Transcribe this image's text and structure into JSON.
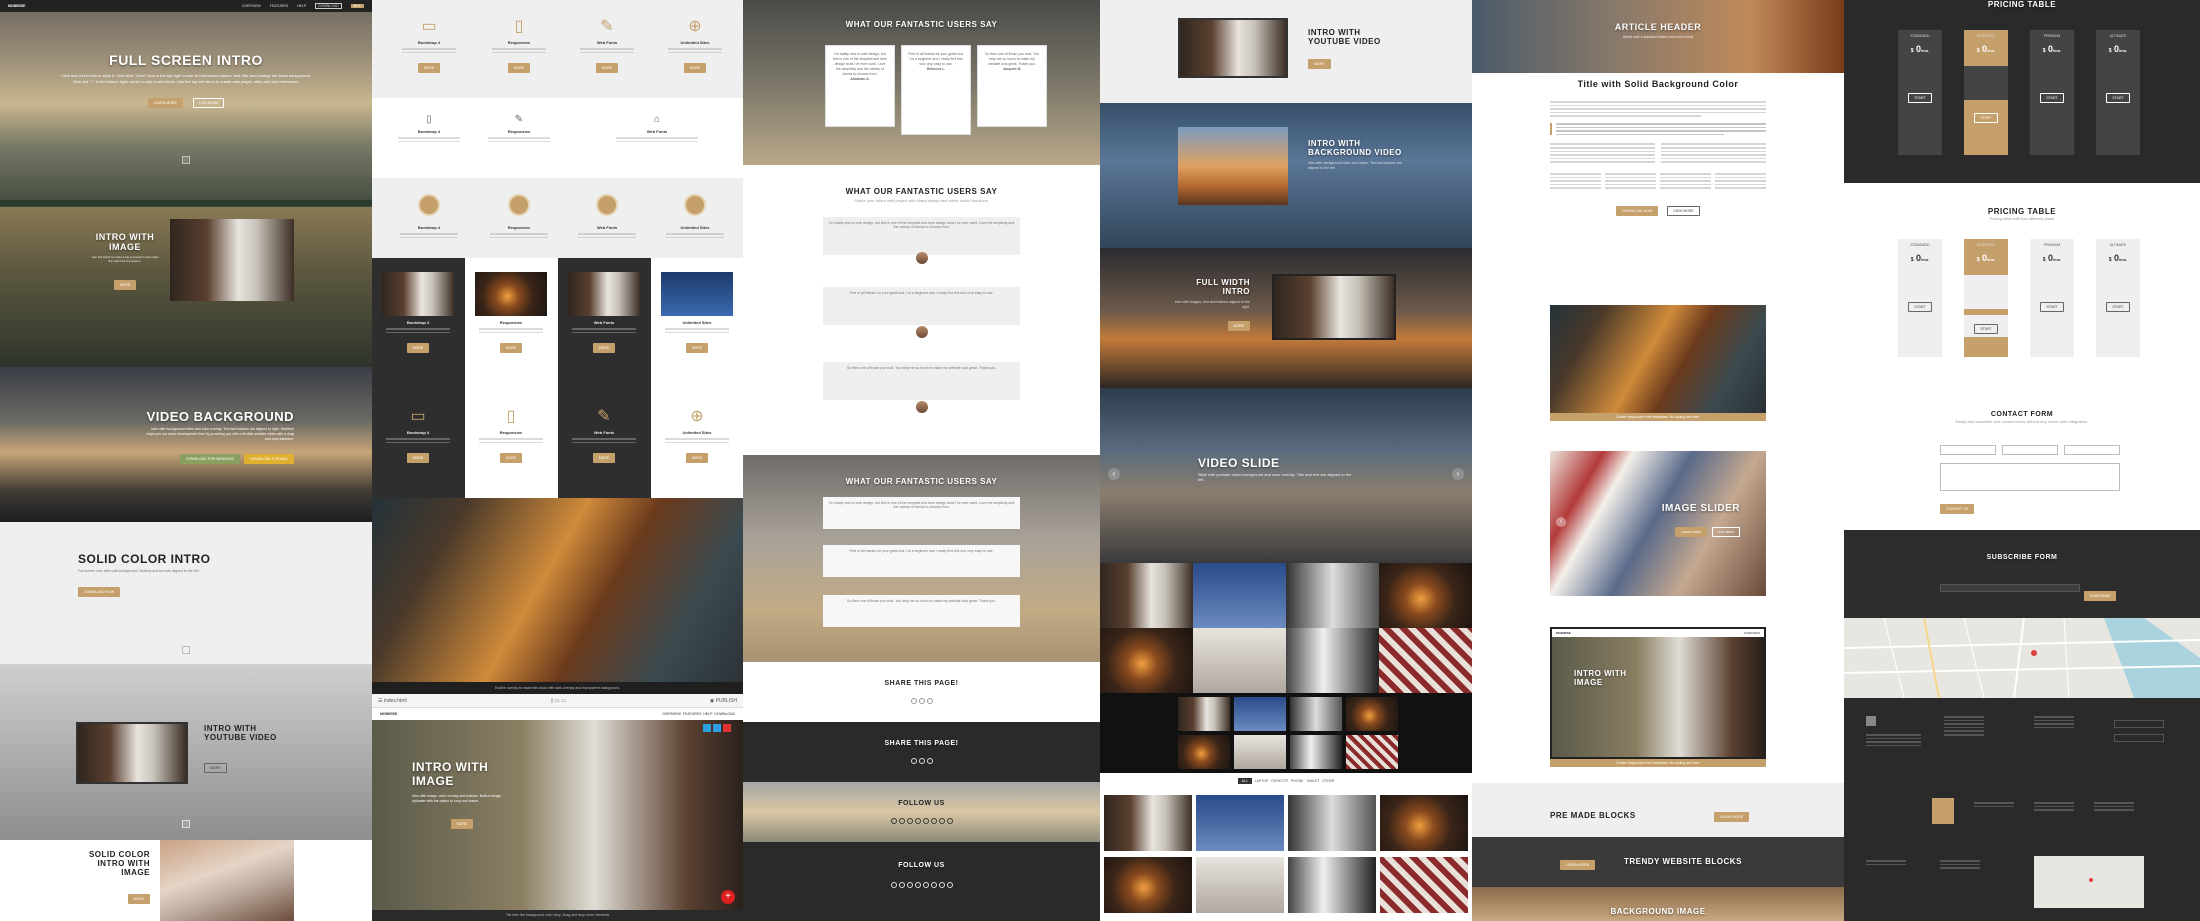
{
  "brand": "MOBIRISE",
  "nav": {
    "items": [
      "OVERVIEW",
      "FEATURES",
      "HELP",
      "DOWNLOAD",
      "BUY"
    ]
  },
  "col1": {
    "full_screen": {
      "title": "FULL SCREEN INTRO",
      "text": "Click any text to edit or style it. Click blue \"Gear\" icon in the top right corner to hide/show buttons, text, title and change the block background. Click red \"+\" in the bottom right corner to add a new block. Use the top left menu to create new pages, sites and add extensions.",
      "btn1": "LEARN MORE",
      "btn2": "LIVE DEMO"
    },
    "intro_image": {
      "title": "INTRO WITH IMAGE",
      "text": "Use this block to make a big impression and make the right first impression.",
      "btn": "MORE"
    },
    "video_bg": {
      "title": "VIDEO BACKGROUND",
      "text": "Intro with background video and color overlay. Text and buttons are aligned to right. Mobirise helps you cut down development time by providing you with a flexible website editor with a drag and drop interface.",
      "btn1": "DOWNLOAD FOR WINDOWS",
      "btn2": "DOWNLOAD FOR MAC"
    },
    "solid": {
      "title": "SOLID COLOR INTRO",
      "text": "Full screen intro with solid background. Buttons and text are aligned to the left.",
      "btn": "DOWNLOAD NOW"
    },
    "youtube": {
      "title": "INTRO WITH YOUTUBE VIDEO",
      "btn": "MORE"
    },
    "solid_image": {
      "title": "SOLID COLOR INTRO WITH IMAGE",
      "btn": "MORE"
    }
  },
  "col2": {
    "features": [
      {
        "name": "Bootstrap 4",
        "icon": "monitor-icon"
      },
      {
        "name": "Responsive",
        "icon": "phone-icon"
      },
      {
        "name": "Web Fonts",
        "icon": "pencil-icon"
      },
      {
        "name": "Unlimited Sites",
        "icon": "globe-icon"
      }
    ],
    "features_btn": "MORE",
    "caption": "Enable overlay to make this block with dark overlay and transparent background.",
    "editor": {
      "filename": "index.html",
      "publish": "PUBLISH",
      "title": "INTRO WITH IMAGE",
      "text": "Intro with image, color overlay and buttons. Built-in image uploader with the option to crop and resize.",
      "btn": "MORE",
      "caption": "Tile intro the background color drop. Drag and drop more elements"
    }
  },
  "col3": {
    "testimonials_title": "WHAT OUR FANTASTIC USERS SAY",
    "testimonials_sub": "Shape your future web project with sharp design and refine coded functions.",
    "quotes": [
      {
        "text": "I'm totally new to web design, but this is one of the simplest and best design tools I've ever used. Love the simplicity and the variety of blocks to choose from.",
        "author": "Abraham A."
      },
      {
        "text": "First of all thanks for your great tool. I'm a beginner and I really find this tool very easy to use.",
        "author": "Rebecca L."
      },
      {
        "text": "So then one of those you took. You help me so much to make my website look great. Thank you.",
        "author": "Jacques M."
      }
    ],
    "share_title": "SHARE THIS PAGE!",
    "follow_title": "FOLLOW US"
  },
  "col4": {
    "youtube": {
      "title": "INTRO WITH YOUTUBE VIDEO",
      "btn": "MORE"
    },
    "bg_video": {
      "title": "INTRO WITH BACKGROUND VIDEO",
      "text": "Intro with background video and button. Text and buttons are aligned to the left."
    },
    "full_width": {
      "title": "FULL WIDTH INTRO",
      "text": "Intro with images, text and buttons aligned to the right.",
      "btn": "MORE"
    },
    "video_slide": {
      "title": "VIDEO SLIDE",
      "text": "Slide with youtube video background and color overlay. Title and text are aligned to the left."
    },
    "filters": [
      "ALL",
      "LAPTOP",
      "DESKTOP",
      "PHONE",
      "TABLET",
      "OTHER"
    ]
  },
  "col5": {
    "article_header": "ARTICLE HEADER",
    "article_sub": "Article with a standard button and a text block",
    "solid_title": "Title with Solid Background Color",
    "btn1": "DOWNLOAD NOW",
    "btn2": "VIEW MORE",
    "caption": "Create responsive free templates. No coding and free.",
    "slider_title": "IMAGE SLIDER",
    "slider_btn1": "LEARN MORE",
    "slider_btn2": "LIVE DEMO",
    "premade": "PRE MADE BLOCKS",
    "premade_btn": "LEARN MORE",
    "trendy": "TRENDY WEBSITE BLOCKS",
    "trendy_btn": "LEARN MORE",
    "bg_image": "BACKGROUND IMAGE"
  },
  "col6": {
    "pricing_title": "PRICING TABLE",
    "pricing_sub": "Pricing table with four different plans",
    "plans": [
      {
        "name": "STANDARD",
        "price": "0"
      },
      {
        "name": "BUSINESS",
        "price": "0"
      },
      {
        "name": "PREMIUM",
        "price": "0"
      },
      {
        "name": "ULTIMATE",
        "price": "0"
      }
    ],
    "currency": "$",
    "per": "/mo.",
    "plan_btn": "START",
    "contact_title": "CONTACT FORM",
    "contact_sub": "Easily add subscribe and contact forms without any server-side integration.",
    "contact_btn": "CONTACT US",
    "subscribe_title": "SUBSCRIBE FORM",
    "subscribe_btn": "SUBSCRIBE"
  }
}
